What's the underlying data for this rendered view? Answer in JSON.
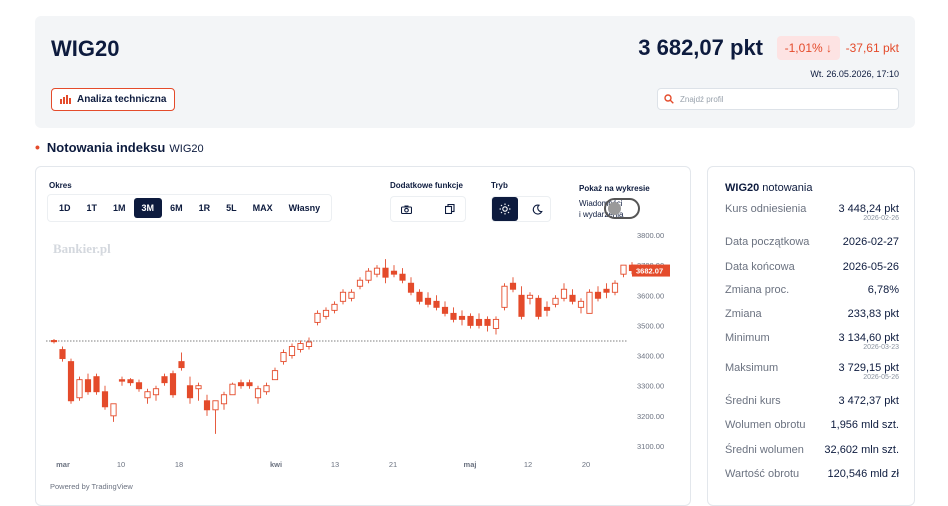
{
  "header": {
    "title": "WIG20",
    "price": "3 682,07 pkt",
    "change_pct": "-1,01% ↓",
    "change_abs": "-37,61 pkt",
    "datetime": "Wt. 26.05.2026, 17:10",
    "analysis_button": "Analiza techniczna",
    "search_placeholder": "Znajdź profil"
  },
  "section": {
    "title": "Notowania indeksu",
    "subtitle": "WIG20"
  },
  "controls": {
    "period_label": "Okres",
    "periods": [
      "1D",
      "1T",
      "1M",
      "3M",
      "6M",
      "1R",
      "5L",
      "MAX",
      "Własny"
    ],
    "active_period": "3M",
    "extra_label": "Dodatkowe funkcje",
    "mode_label": "Tryb",
    "news_label": "Pokaż na wykresie",
    "news_sub1": "Wiadomości",
    "news_sub2": "i wydarzenia",
    "news_toggle": false
  },
  "chart_data": {
    "type": "candlestick",
    "watermark": "Bankier.pl",
    "credit": "Powered by TradingView",
    "y_ticks": [
      "3800.00",
      "3700.00",
      "3600.00",
      "3500.00",
      "3400.00",
      "3300.00",
      "3200.00",
      "3100.00"
    ],
    "ylim": [
      3080,
      3810
    ],
    "x_ticks": [
      "mar",
      "10",
      "18",
      "kwi",
      "13",
      "21",
      "maj",
      "12",
      "20"
    ],
    "last_price_label": "3682.07",
    "reference_level": 3448.24,
    "candles": [
      [
        3450,
        3455,
        3440,
        3446
      ],
      [
        3420,
        3430,
        3380,
        3390
      ],
      [
        3380,
        3390,
        3240,
        3250
      ],
      [
        3260,
        3330,
        3250,
        3320
      ],
      [
        3320,
        3340,
        3270,
        3280
      ],
      [
        3330,
        3340,
        3270,
        3280
      ],
      [
        3280,
        3300,
        3220,
        3230
      ],
      [
        3200,
        3240,
        3180,
        3240
      ],
      [
        3320,
        3330,
        3300,
        3315
      ],
      [
        3320,
        3325,
        3300,
        3310
      ],
      [
        3310,
        3320,
        3280,
        3290
      ],
      [
        3260,
        3290,
        3240,
        3280
      ],
      [
        3270,
        3300,
        3250,
        3290
      ],
      [
        3330,
        3340,
        3300,
        3310
      ],
      [
        3340,
        3350,
        3260,
        3270
      ],
      [
        3380,
        3410,
        3350,
        3360
      ],
      [
        3300,
        3330,
        3240,
        3260
      ],
      [
        3290,
        3310,
        3250,
        3300
      ],
      [
        3250,
        3270,
        3200,
        3220
      ],
      [
        3220,
        3240,
        3140,
        3250
      ],
      [
        3240,
        3280,
        3220,
        3270
      ],
      [
        3270,
        3310,
        3270,
        3305
      ],
      [
        3310,
        3320,
        3290,
        3300
      ],
      [
        3310,
        3320,
        3290,
        3300
      ],
      [
        3260,
        3300,
        3240,
        3290
      ],
      [
        3280,
        3310,
        3270,
        3300
      ],
      [
        3320,
        3360,
        3320,
        3350
      ],
      [
        3380,
        3420,
        3370,
        3410
      ],
      [
        3400,
        3440,
        3390,
        3430
      ],
      [
        3420,
        3450,
        3410,
        3440
      ],
      [
        3430,
        3460,
        3420,
        3445
      ],
      [
        3510,
        3550,
        3500,
        3540
      ],
      [
        3530,
        3560,
        3520,
        3550
      ],
      [
        3550,
        3580,
        3540,
        3570
      ],
      [
        3580,
        3620,
        3570,
        3610
      ],
      [
        3590,
        3620,
        3580,
        3610
      ],
      [
        3630,
        3660,
        3620,
        3650
      ],
      [
        3650,
        3690,
        3640,
        3680
      ],
      [
        3670,
        3700,
        3660,
        3690
      ],
      [
        3690,
        3720,
        3640,
        3660
      ],
      [
        3680,
        3700,
        3660,
        3670
      ],
      [
        3670,
        3690,
        3640,
        3650
      ],
      [
        3640,
        3660,
        3600,
        3610
      ],
      [
        3610,
        3620,
        3570,
        3580
      ],
      [
        3590,
        3610,
        3560,
        3570
      ],
      [
        3580,
        3600,
        3550,
        3560
      ],
      [
        3560,
        3580,
        3530,
        3540
      ],
      [
        3540,
        3560,
        3510,
        3520
      ],
      [
        3530,
        3550,
        3500,
        3520
      ],
      [
        3530,
        3540,
        3490,
        3500
      ],
      [
        3520,
        3540,
        3490,
        3500
      ],
      [
        3520,
        3530,
        3480,
        3500
      ],
      [
        3490,
        3530,
        3470,
        3520
      ],
      [
        3560,
        3640,
        3550,
        3630
      ],
      [
        3640,
        3660,
        3610,
        3620
      ],
      [
        3600,
        3630,
        3520,
        3530
      ],
      [
        3590,
        3610,
        3570,
        3600
      ],
      [
        3590,
        3600,
        3520,
        3530
      ],
      [
        3560,
        3580,
        3530,
        3550
      ],
      [
        3570,
        3600,
        3560,
        3590
      ],
      [
        3590,
        3640,
        3580,
        3620
      ],
      [
        3600,
        3620,
        3570,
        3580
      ],
      [
        3560,
        3590,
        3540,
        3580
      ],
      [
        3540,
        3620,
        3540,
        3610
      ],
      [
        3610,
        3630,
        3580,
        3590
      ],
      [
        3620,
        3640,
        3590,
        3610
      ],
      [
        3610,
        3650,
        3600,
        3640
      ],
      [
        3670,
        3700,
        3660,
        3700
      ],
      [
        3700,
        3710,
        3670,
        3682
      ]
    ]
  },
  "quote": {
    "heading_bold": "WIG20",
    "heading_rest": "notowania",
    "rows": [
      {
        "k": "Kurs odniesienia",
        "v": "3 448,24 pkt",
        "d": "2026-02-26"
      },
      {
        "k": "Data początkowa",
        "v": "2026-02-27",
        "d": ""
      },
      {
        "k": "Data końcowa",
        "v": "2026-05-26",
        "d": ""
      },
      {
        "k": "Zmiana proc.",
        "v": "6,78%",
        "d": ""
      },
      {
        "k": "Zmiana",
        "v": "233,83 pkt",
        "d": ""
      },
      {
        "k": "Minimum",
        "v": "3 134,60 pkt",
        "d": "2026-03-23"
      },
      {
        "k": "Maksimum",
        "v": "3 729,15 pkt",
        "d": "2026-05-26"
      },
      {
        "k": "Średni kurs",
        "v": "3 472,37 pkt",
        "d": ""
      },
      {
        "k": "Wolumen obrotu",
        "v": "1,956 mld szt.",
        "d": ""
      },
      {
        "k": "Średni wolumen",
        "v": "32,602 mln szt.",
        "d": ""
      },
      {
        "k": "Wartość obrotu",
        "v": "120,546 mld zł",
        "d": ""
      }
    ]
  },
  "colors": {
    "up": "#e44b2b",
    "down": "#e44b2b",
    "navy": "#0d1b3e"
  }
}
